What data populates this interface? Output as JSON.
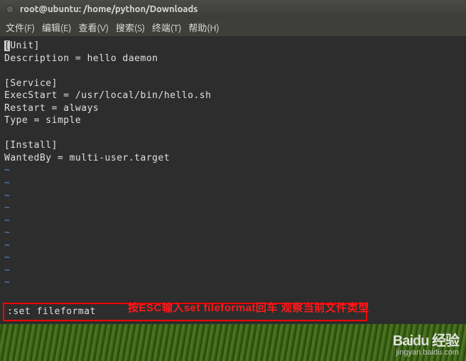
{
  "window": {
    "title": "root@ubuntu: /home/python/Downloads"
  },
  "menubar": {
    "file": "文件(F)",
    "edit": "编辑(E)",
    "view": "查看(V)",
    "search": "搜索(S)",
    "terminal": "终端(T)",
    "help": "帮助(H)"
  },
  "editor": {
    "lines": [
      "[Unit]",
      "Description = hello daemon",
      "",
      "[Service]",
      "ExecStart = /usr/local/bin/hello.sh",
      "Restart = always",
      "Type = simple",
      "",
      "[Install]",
      "WantedBy = multi-user.target"
    ],
    "cursor_char": "[",
    "tilde": "~",
    "command": ":set fileformat"
  },
  "annotation": {
    "text": "按ESC输入set fileformat回车 观察当前文件类型"
  },
  "watermark": {
    "brand_left": "Bai",
    "brand_right": "du",
    "brand_cn": "经验",
    "url": "jingyan.baidu.com"
  }
}
